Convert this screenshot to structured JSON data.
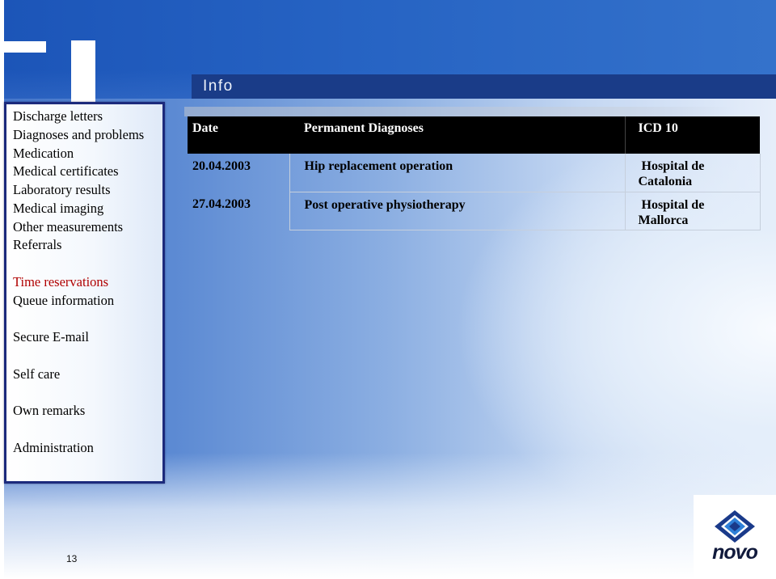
{
  "header": {
    "title": "Info"
  },
  "sidebar": {
    "groups": [
      {
        "items": [
          {
            "label": "Discharge letters"
          },
          {
            "label": "Diagnoses and problems"
          },
          {
            "label": "Medication"
          },
          {
            "label": "Medical certificates"
          },
          {
            "label": "Laboratory results"
          },
          {
            "label": "Medical imaging"
          },
          {
            "label": "Other measurements"
          },
          {
            "label": "Referrals"
          }
        ]
      },
      {
        "items": [
          {
            "label": "Time reservations",
            "active": true
          },
          {
            "label": "Queue information"
          }
        ]
      },
      {
        "items": [
          {
            "label": "Secure E-mail"
          }
        ]
      },
      {
        "items": [
          {
            "label": "Self care"
          }
        ]
      },
      {
        "items": [
          {
            "label": "Own remarks"
          }
        ]
      },
      {
        "items": [
          {
            "label": "Administration"
          }
        ]
      }
    ]
  },
  "table": {
    "columns": [
      "Date",
      "Permanent Diagnoses",
      "ICD 10"
    ],
    "rows": [
      [
        "20.04.2003",
        "Hip replacement operation",
        "Hospital de Catalonia"
      ],
      [
        "27.04.2003",
        "Post operative physiotherapy",
        "Hospital de Mallorca"
      ]
    ]
  },
  "footer": {
    "page_number": "13"
  },
  "logo": {
    "text": "novo",
    "icon": "novo-logo-icon"
  },
  "colors": {
    "title_bar": "#1a3c88",
    "sidebar_border": "#1c2a7c",
    "active_item": "#b00000",
    "table_header_bg": "#000000",
    "table_header_text": "#ffffff",
    "logo_navy": "#1a3a8a",
    "logo_blue": "#2f80d8"
  }
}
